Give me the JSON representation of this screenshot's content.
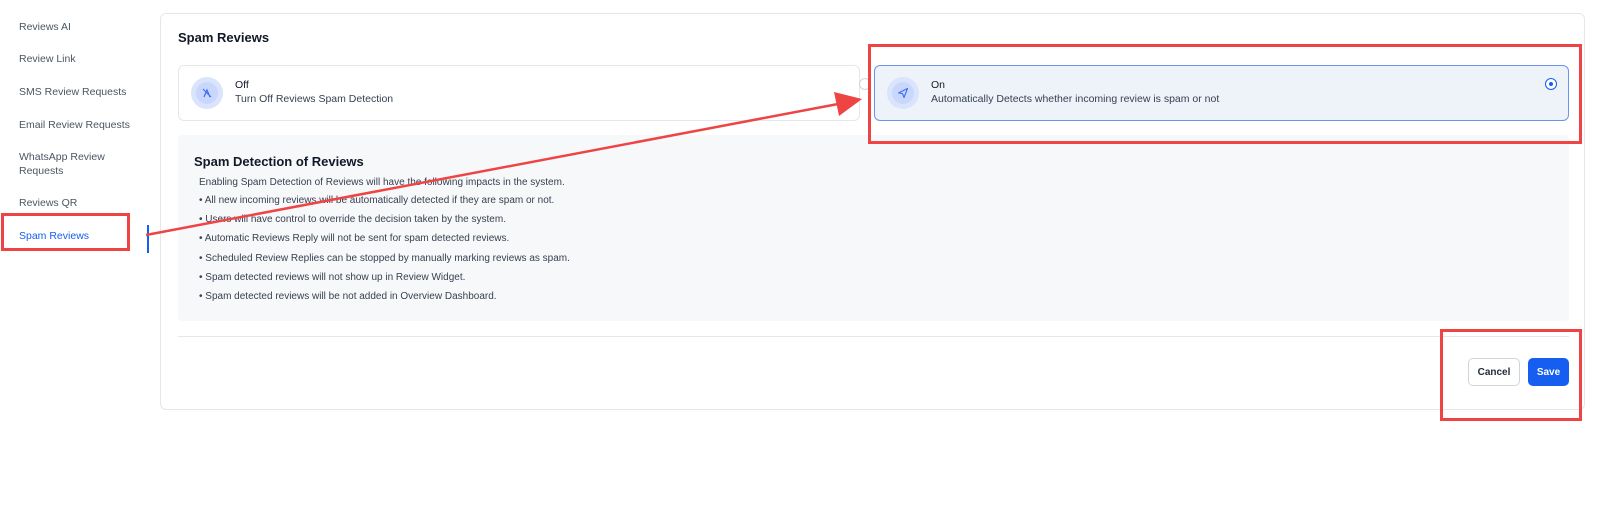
{
  "sidebar": {
    "items": [
      {
        "label": "Reviews AI"
      },
      {
        "label": "Review Link"
      },
      {
        "label": "SMS Review Requests"
      },
      {
        "label": "Email Review Requests"
      },
      {
        "label": "WhatsApp Review Requests"
      },
      {
        "label": "Reviews QR"
      },
      {
        "label": "Spam Reviews",
        "active": true
      }
    ]
  },
  "main": {
    "title": "Spam Reviews",
    "options": [
      {
        "title": "Off",
        "description": "Turn Off Reviews Spam Detection",
        "icon": "spam-off-icon",
        "selected": false
      },
      {
        "title": "On",
        "description": "Automatically Detects whether incoming review is spam or not",
        "icon": "send-icon",
        "selected": true
      }
    ],
    "info": {
      "title": "Spam Detection of Reviews",
      "intro": "Enabling Spam Detection of Reviews will have the following impacts in the system.",
      "bullets": [
        "• All new incoming reviews will be automatically detected if they are spam or not.",
        "• Users will have control to override the decision taken by the system.",
        "• Automatic Reviews Reply will not be sent for spam detected reviews.",
        "• Scheduled Review Replies can be stopped by manually marking reviews as spam.",
        "• Spam detected reviews will not show up in Review Widget.",
        "• Spam detected reviews will be not added in Overview Dashboard."
      ]
    },
    "actions": {
      "cancel_label": "Cancel",
      "save_label": "Save"
    }
  },
  "colors": {
    "accent": "#155eef",
    "annotation": "#ef4444",
    "selected_bg": "#eef2f9"
  }
}
